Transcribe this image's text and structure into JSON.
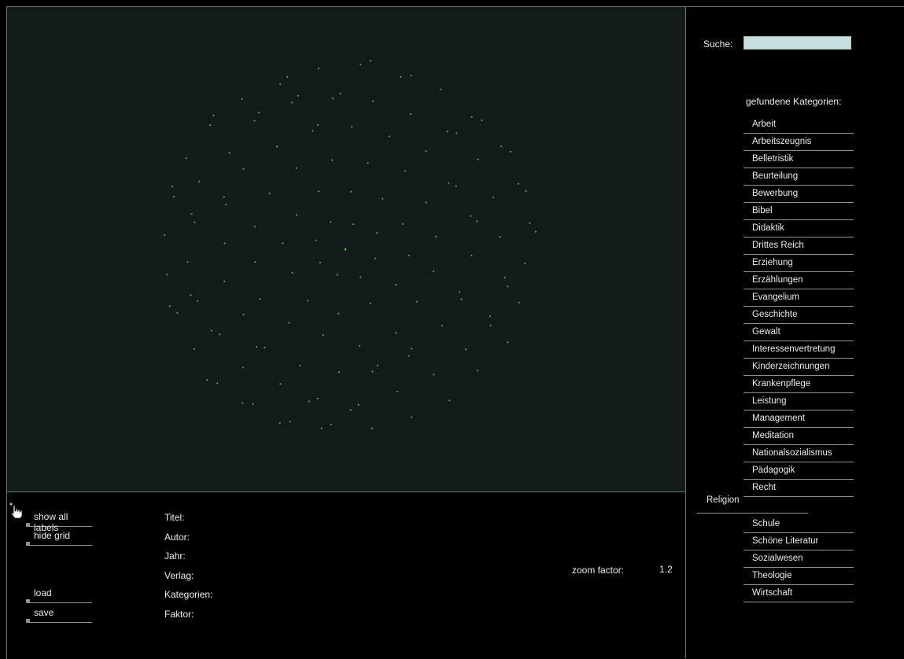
{
  "left_buttons": [
    {
      "label": "show all labels"
    },
    {
      "label": "hide grid"
    },
    {
      "label": "load"
    },
    {
      "label": "save"
    }
  ],
  "info_fields": [
    {
      "label": "Titel:"
    },
    {
      "label": "Autor:"
    },
    {
      "label": "Jahr:"
    },
    {
      "label": "Verlag:"
    },
    {
      "label": "Kategorien:"
    },
    {
      "label": "Faktor:"
    }
  ],
  "zoom": {
    "label": "zoom factor:",
    "value": "1.2"
  },
  "search": {
    "label": "Suche:",
    "value": ""
  },
  "categories_heading": "gefundene Kategorien:",
  "categories": [
    "Arbeit",
    "Arbeitszeugnis",
    "Belletristik",
    "Beurteilung",
    "Bewerbung",
    "Bibel",
    "Didaktik",
    "Drittes Reich",
    "Erziehung",
    "Erzählungen",
    "Evangelium",
    "Geschichte",
    "Gewalt",
    "Interessenvertretung",
    "Kinderzeichnungen",
    "Krankenpflege",
    "Leistung",
    "Management",
    "Meditation",
    "Nationalsozialismus",
    "Pädagogik",
    "Recht",
    "Religion",
    "Schule",
    "Schöne Literatur",
    "Sozialwesen",
    "Theologie",
    "Wirtschaft"
  ],
  "dragged_category": "Religion",
  "colors": {
    "viz_bg": "#111b1a",
    "dot": "#8a9a96",
    "dot_active": "#5fd36a",
    "search_bg": "#c5dedf"
  },
  "icons": {
    "cursor": "hand-pointer-icon"
  }
}
